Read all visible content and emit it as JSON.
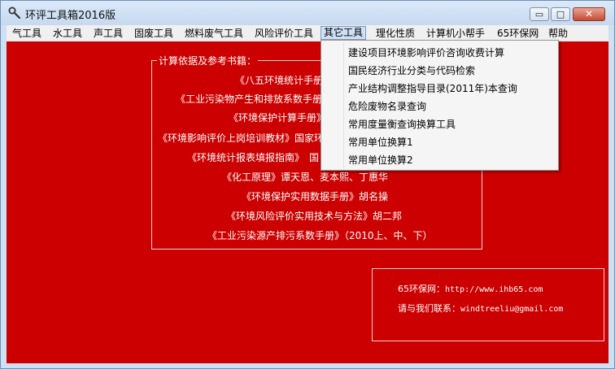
{
  "window": {
    "title": "环评工具箱2016版",
    "controls": {
      "minimize": "▭",
      "maximize": "□",
      "close": "✕"
    }
  },
  "menu": {
    "items": [
      {
        "label": "气工具"
      },
      {
        "label": "水工具"
      },
      {
        "label": "声工具"
      },
      {
        "label": "固废工具"
      },
      {
        "label": "燃料废气工具"
      },
      {
        "label": "风险评价工具"
      },
      {
        "label": "其它工具"
      },
      {
        "label": "理化性质"
      },
      {
        "label": "计算机小帮手"
      },
      {
        "label": "65环保网"
      },
      {
        "label": "帮助"
      }
    ]
  },
  "dropdown": {
    "items": [
      {
        "label": "建设项目环境影响评价咨询收费计算"
      },
      {
        "label": "国民经济行业分类与代码检索"
      },
      {
        "label": "产业结构调整指导目录(2011年)本查询"
      },
      {
        "label": "危险废物名录查询"
      },
      {
        "label": "常用度量衡查询换算工具"
      },
      {
        "label": "常用单位换算1"
      },
      {
        "label": "常用单位换算2"
      }
    ]
  },
  "references": {
    "title": "计算依据及参考书籍：",
    "items": [
      "《八五环境统计手册》",
      "《工业污染物产生和排放系数手册》",
      "《环境保护计算手册》",
      "《环境影响评价上岗培训教材》国家环",
      "《环境统计报表填报指南》　国",
      "《化工原理》谭天恩、麦本熙、丁惠华",
      "《环境保护实用数据手册》胡名操",
      "《环境风险评价实用技术与方法》胡二邦",
      "《工业污染源产排污系数手册》（2010上、中、下）"
    ]
  },
  "contact": {
    "site_label": "65环保网：",
    "site_url": "http://www.ihb65.com",
    "email_label": "请与我们联系：",
    "email": "windtreeliu@gmail.com"
  },
  "colors": {
    "content_bg": "#cc0000",
    "menubar_bg": "#f0f0f0",
    "dropdown_bg": "#f5f5f5"
  }
}
